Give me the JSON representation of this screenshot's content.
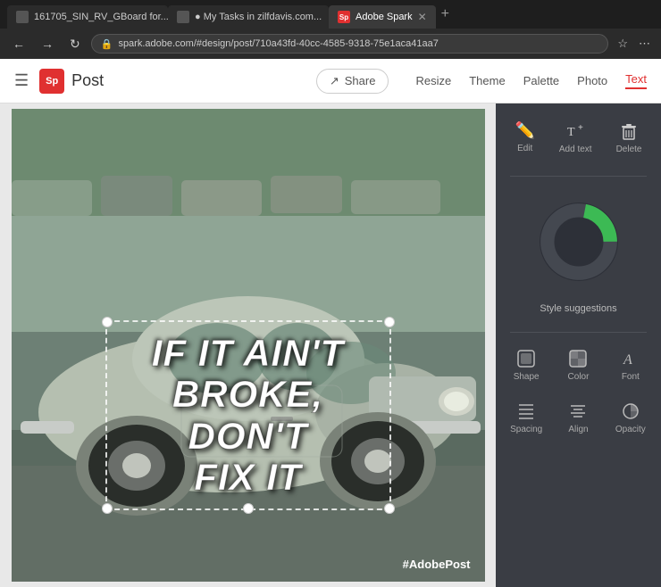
{
  "browser": {
    "tabs": [
      {
        "id": "tab1",
        "label": "161705_SIN_RV_GBoard for...",
        "favicon_type": "generic",
        "active": false
      },
      {
        "id": "tab2",
        "label": "● My Tasks in zilfdavis.com...",
        "favicon_type": "generic",
        "active": false
      },
      {
        "id": "tab3",
        "label": "Adobe Spark",
        "favicon_type": "sp",
        "active": true
      }
    ],
    "address": "spark.adobe.com/#design/post/710a43fd-40cc-4585-9318-75e1aca41aa7",
    "nav_back": "←",
    "nav_forward": "→",
    "nav_refresh": "↻",
    "new_tab": "+"
  },
  "app": {
    "menu_icon": "☰",
    "brand": {
      "logo": "Sp",
      "name": "Post"
    },
    "share_label": "Share",
    "toolbar_items": [
      "Resize",
      "Theme",
      "Palette",
      "Photo",
      "Text"
    ],
    "active_toolbar": "Text"
  },
  "panel": {
    "edit_label": "Edit",
    "add_text_label": "Add text",
    "delete_label": "Delete",
    "donut_label": "Style suggestions",
    "grid_items": [
      {
        "id": "shape",
        "label": "Shape"
      },
      {
        "id": "color",
        "label": "Color"
      },
      {
        "id": "font",
        "label": "Font"
      },
      {
        "id": "spacing",
        "label": "Spacing"
      },
      {
        "id": "align",
        "label": "Align"
      },
      {
        "id": "opacity",
        "label": "Opacity"
      }
    ]
  },
  "canvas": {
    "text_line1": "If it ain't",
    "text_line2": "broke, don't",
    "text_line3": "fix it",
    "hashtag": "#AdobePost"
  },
  "colors": {
    "accent_green": "#3cba54",
    "panel_bg": "#3a3d44",
    "donut_dark": "#2d3038",
    "donut_green": "#3cba54",
    "brand_red": "#e03030",
    "active_tab_text": "#e03030"
  }
}
